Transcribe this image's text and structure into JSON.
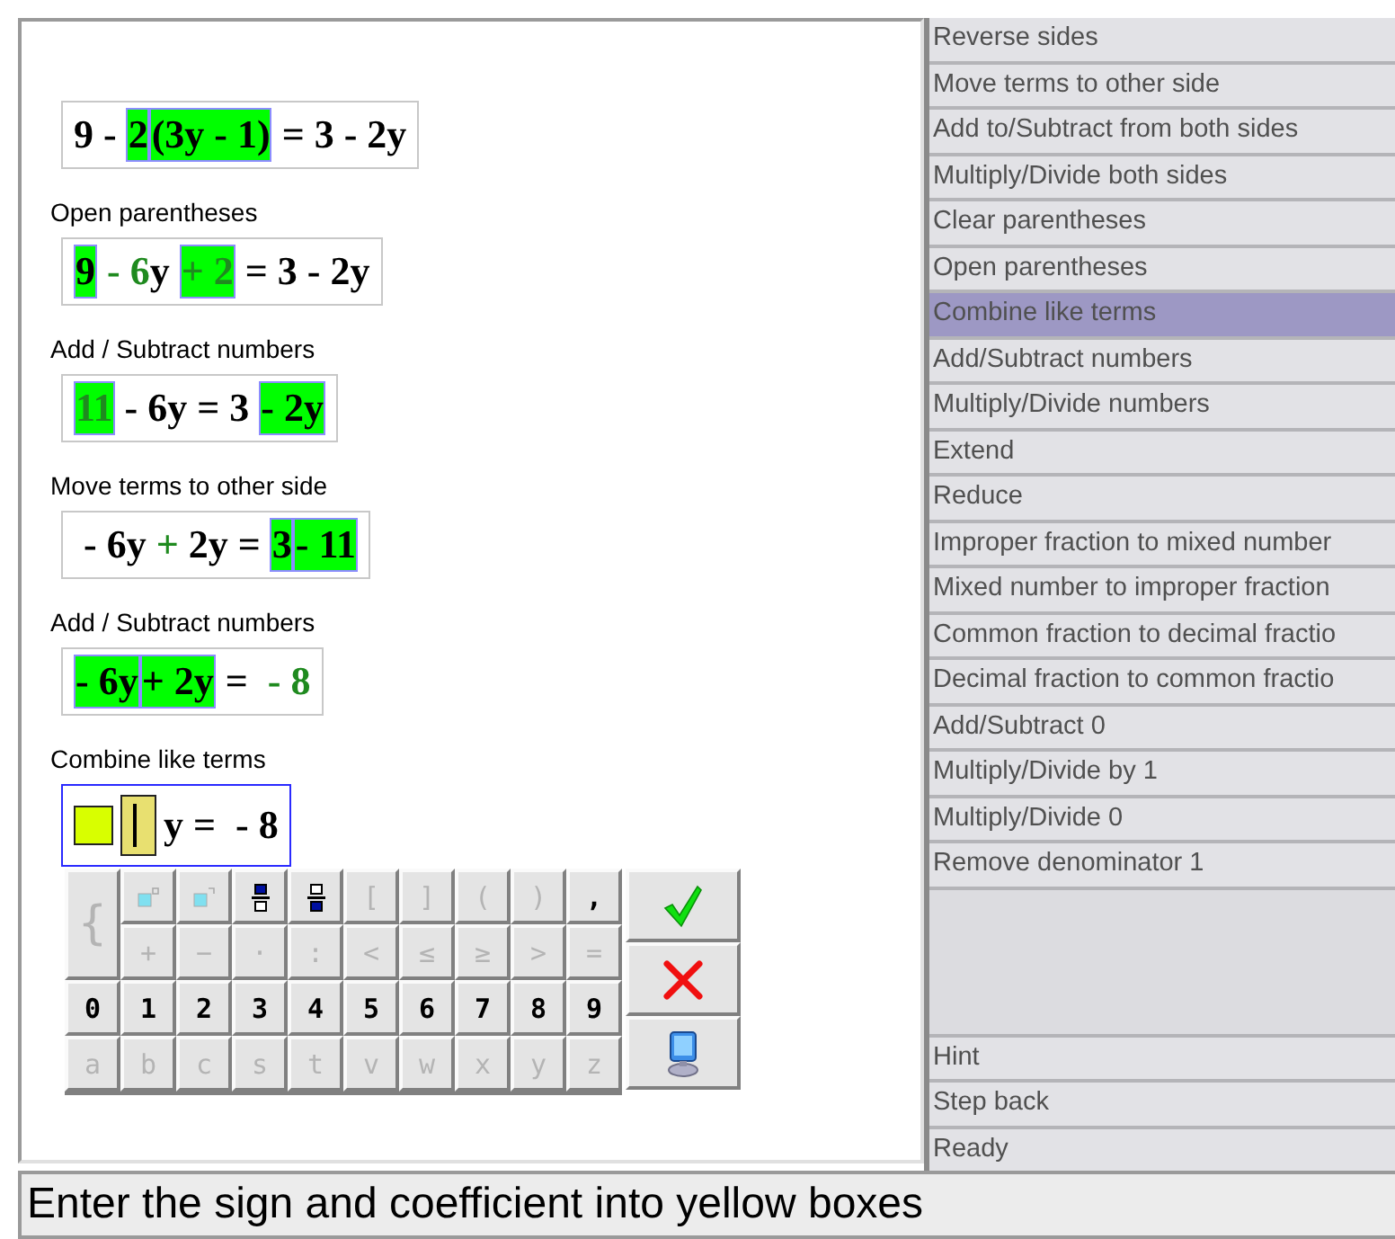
{
  "steps": [
    {
      "segments": [
        {
          "text": "9 - ",
          "highlighted": false,
          "changed": false
        },
        {
          "text": "2",
          "highlighted": true,
          "changed": false
        },
        {
          "text": "(3y - 1)",
          "highlighted": true,
          "changed": false
        },
        {
          "text": " = 3 - 2y",
          "highlighted": false,
          "changed": false
        }
      ]
    },
    {
      "label": "Open parentheses",
      "segments": [
        {
          "text": "9",
          "highlighted": true,
          "changed": false
        },
        {
          "text": " - 6",
          "highlighted": false,
          "changed": true
        },
        {
          "text": "y ",
          "highlighted": false,
          "changed": false
        },
        {
          "text": "+ 2",
          "highlighted": true,
          "changed": true
        },
        {
          "text": " = 3 - 2y",
          "highlighted": false,
          "changed": false
        }
      ]
    },
    {
      "label": "Add / Subtract numbers",
      "segments": [
        {
          "text": "11",
          "highlighted": true,
          "changed": true
        },
        {
          "text": " - 6y = 3 ",
          "highlighted": false,
          "changed": false
        },
        {
          "text": "- 2y",
          "highlighted": true,
          "changed": false
        }
      ]
    },
    {
      "label": "Move terms to other side",
      "segments": [
        {
          "text": " - 6y ",
          "highlighted": false,
          "changed": false
        },
        {
          "text": "+",
          "highlighted": false,
          "changed": true
        },
        {
          "text": " 2y = ",
          "highlighted": false,
          "changed": false
        },
        {
          "text": "3",
          "highlighted": true,
          "changed": false
        },
        {
          "text": "- 11",
          "highlighted": true,
          "changed": false
        }
      ]
    },
    {
      "label": "Add / Subtract numbers",
      "segments": [
        {
          "text": "- 6y",
          "highlighted": true,
          "changed": false
        },
        {
          "text": "+ 2y",
          "highlighted": true,
          "changed": false
        },
        {
          "text": " =  ",
          "highlighted": false,
          "changed": false
        },
        {
          "text": "- 8",
          "highlighted": false,
          "changed": true
        }
      ]
    },
    {
      "label": "Combine like terms",
      "active": true,
      "segments": [
        {
          "kind": "slot",
          "focused": false
        },
        {
          "kind": "slot",
          "focused": true
        },
        {
          "text": "y =  - 8",
          "highlighted": false,
          "changed": false
        }
      ]
    }
  ],
  "keypad": {
    "brace_key": {
      "label": "{",
      "disabled": true
    },
    "symbol_rows": [
      [
        {
          "kind": "power",
          "disabled": true
        },
        {
          "kind": "index",
          "disabled": true
        },
        {
          "kind": "numerator",
          "disabled": false
        },
        {
          "kind": "denominator",
          "disabled": false
        },
        {
          "label": "[",
          "disabled": true
        },
        {
          "label": "]",
          "disabled": true
        },
        {
          "label": "(",
          "disabled": true
        },
        {
          "label": ")",
          "disabled": true
        },
        {
          "label": ",",
          "disabled": false
        }
      ],
      [
        {
          "label": "+",
          "disabled": true
        },
        {
          "label": "−",
          "disabled": true
        },
        {
          "label": "·",
          "disabled": true
        },
        {
          "label": ":",
          "disabled": true
        },
        {
          "label": "<",
          "disabled": true
        },
        {
          "label": "≤",
          "disabled": true
        },
        {
          "label": "≥",
          "disabled": true
        },
        {
          "label": ">",
          "disabled": true
        },
        {
          "label": "=",
          "disabled": true
        }
      ]
    ],
    "rows": [
      [
        {
          "label": "0",
          "disabled": false
        },
        {
          "label": "1",
          "disabled": false
        },
        {
          "label": "2",
          "disabled": false
        },
        {
          "label": "3",
          "disabled": false
        },
        {
          "label": "4",
          "disabled": false
        },
        {
          "label": "5",
          "disabled": false
        },
        {
          "label": "6",
          "disabled": false
        },
        {
          "label": "7",
          "disabled": false
        },
        {
          "label": "8",
          "disabled": false
        },
        {
          "label": "9",
          "disabled": false
        }
      ],
      [
        {
          "label": "a",
          "disabled": true
        },
        {
          "label": "b",
          "disabled": true
        },
        {
          "label": "c",
          "disabled": true
        },
        {
          "label": "s",
          "disabled": true
        },
        {
          "label": "t",
          "disabled": true
        },
        {
          "label": "v",
          "disabled": true
        },
        {
          "label": "w",
          "disabled": true
        },
        {
          "label": "x",
          "disabled": true
        },
        {
          "label": "y",
          "disabled": true
        },
        {
          "label": "z",
          "disabled": true
        }
      ]
    ],
    "actions": [
      {
        "kind": "confirm"
      },
      {
        "kind": "cancel"
      },
      {
        "kind": "computer"
      }
    ]
  },
  "rules": [
    {
      "label": "Reverse sides",
      "selected": false
    },
    {
      "label": "Move terms to other side",
      "selected": false
    },
    {
      "label": "Add to/Subtract from both sides",
      "selected": false
    },
    {
      "label": "Multiply/Divide both sides",
      "selected": false
    },
    {
      "label": "Clear parentheses",
      "selected": false
    },
    {
      "label": "Open parentheses",
      "selected": false
    },
    {
      "label": "Combine like terms",
      "selected": true
    },
    {
      "label": "Add/Subtract numbers",
      "selected": false
    },
    {
      "label": "Multiply/Divide numbers",
      "selected": false
    },
    {
      "label": "Extend",
      "selected": false
    },
    {
      "label": "Reduce",
      "selected": false
    },
    {
      "label": "Improper fraction to mixed number",
      "selected": false
    },
    {
      "label": "Mixed number to improper fraction",
      "selected": false
    },
    {
      "label": "Common fraction to decimal fractio",
      "selected": false
    },
    {
      "label": "Decimal fraction to common fractio",
      "selected": false
    },
    {
      "label": "Add/Subtract 0",
      "selected": false
    },
    {
      "label": "Multiply/Divide by 1",
      "selected": false
    },
    {
      "label": "Multiply/Divide 0",
      "selected": false
    },
    {
      "label": "Remove denominator 1",
      "selected": false
    }
  ],
  "commands": [
    "Hint",
    "Step back",
    "Ready"
  ],
  "status_bar": "Enter the sign and coefficient into yellow boxes"
}
